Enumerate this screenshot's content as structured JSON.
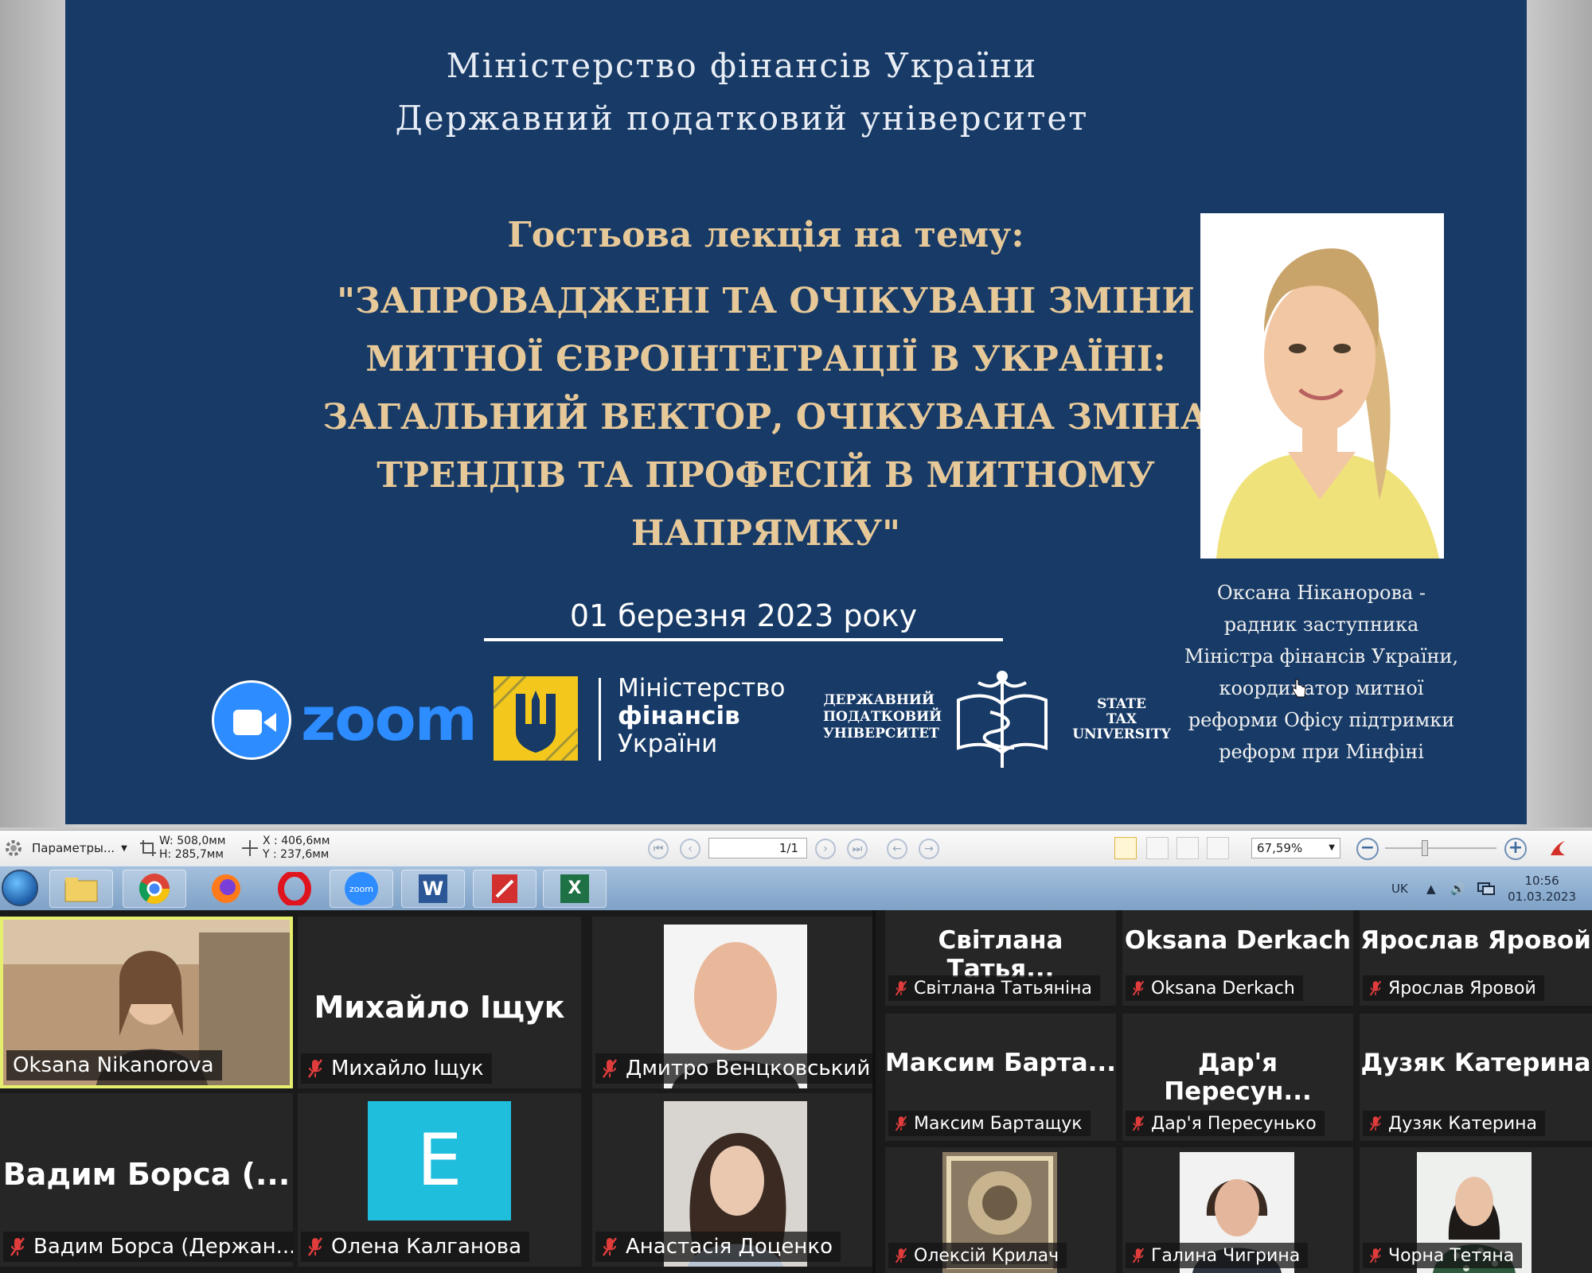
{
  "slide": {
    "ministry_line1": "Міністерство фінансів України",
    "ministry_line2": "Державний податковий університет",
    "lecture_heading": "Гостьова лекція на тему:",
    "topic_line1": "\"ЗАПРОВАДЖЕНІ ТА ОЧІКУВАНІ ЗМІНИ",
    "topic_line2": "МИТНОЇ ЄВРОІНТЕГРАЦІЇ В УКРАЇНІ:",
    "topic_line3": "ЗАГАЛЬНИЙ ВЕКТОР, ОЧІКУВАНА ЗМІНА",
    "topic_line4": "ТРЕНДІВ ТА ПРОФЕСІЙ В МИТНОМУ",
    "topic_line5": "НАПРЯМКУ\"",
    "date": "01 березня 2023 року",
    "speaker_line1": "Оксана Ніканорова -",
    "speaker_line2": "радник заступника",
    "speaker_line3": "Міністра фінансів України,",
    "speaker_line4": "координатор митної",
    "speaker_line5": "реформи Офісу підтримки",
    "speaker_line6": "реформ при Мінфіні",
    "zoom_logo_text": "zoom",
    "minfin_line1": "Міністерство",
    "minfin_line2": "фінансів",
    "minfin_line3": "України",
    "dpu_left_line1": "ДЕРЖАВНИЙ",
    "dpu_left_line2": "ПОДАТКОВИЙ",
    "dpu_left_line3": "УНІВЕРСИТЕТ",
    "dpu_right_line1": "STATE",
    "dpu_right_line2": "TAX",
    "dpu_right_line3": "UNIVERSITY"
  },
  "pdf_toolbar": {
    "params_label": "Параметры...",
    "width_readout": "W: 508,0мм",
    "height_readout": "H: 285,7мм",
    "x_readout": "X : 406,6мм",
    "y_readout": "Y : 237,6мм",
    "page_value": "1/1",
    "zoom_value": "67,59%"
  },
  "taskbar": {
    "apps": [
      "file-explorer",
      "chrome",
      "firefox",
      "opera",
      "zoom",
      "word",
      "pdf-editor",
      "excel"
    ],
    "zoom_app_label": "zoom",
    "language": "UK",
    "time": "10:56",
    "date": "01.03.2023"
  },
  "gallery": {
    "tiles": [
      {
        "display": "",
        "tag": "Oksana Nikanorova"
      },
      {
        "display": "Михайло Іщук",
        "tag": "Михайло Іщук"
      },
      {
        "display": "",
        "tag": "Дмитро Венцковський"
      },
      {
        "display": "Вадим Борса (...",
        "tag": "Вадим Борса (Держан..."
      },
      {
        "display": "E",
        "tag": "Олена Калганова"
      },
      {
        "display": "",
        "tag": "Анастасія Доценко"
      },
      {
        "display": "Світлана Татья...",
        "tag": "Світлана Татьяніна"
      },
      {
        "display": "Oksana Derkach",
        "tag": "Oksana Derkach"
      },
      {
        "display": "Ярослав Яровой",
        "tag": "Ярослав Яровой"
      },
      {
        "display": "Максим Барта...",
        "tag": "Максим Бартащук"
      },
      {
        "display": "Дар'я Пересун...",
        "tag": "Дар'я Пересунько"
      },
      {
        "display": "Дузяк Катерина",
        "tag": "Дузяк Катерина"
      },
      {
        "display": "",
        "tag": "Олексій Крилач"
      },
      {
        "display": "",
        "tag": "Галина Чигрина"
      },
      {
        "display": "",
        "tag": "Чорна Тетяна"
      }
    ]
  },
  "colors": {
    "slide_bg": "#173a66",
    "title_gold": "#e7c999",
    "zoom_blue": "#2d8cff",
    "minfin_yellow": "#f3c71c",
    "active_speaker": "#e6ef6d",
    "mic_muted": "#e03c3c",
    "avatar_e": "#1fbedd"
  }
}
